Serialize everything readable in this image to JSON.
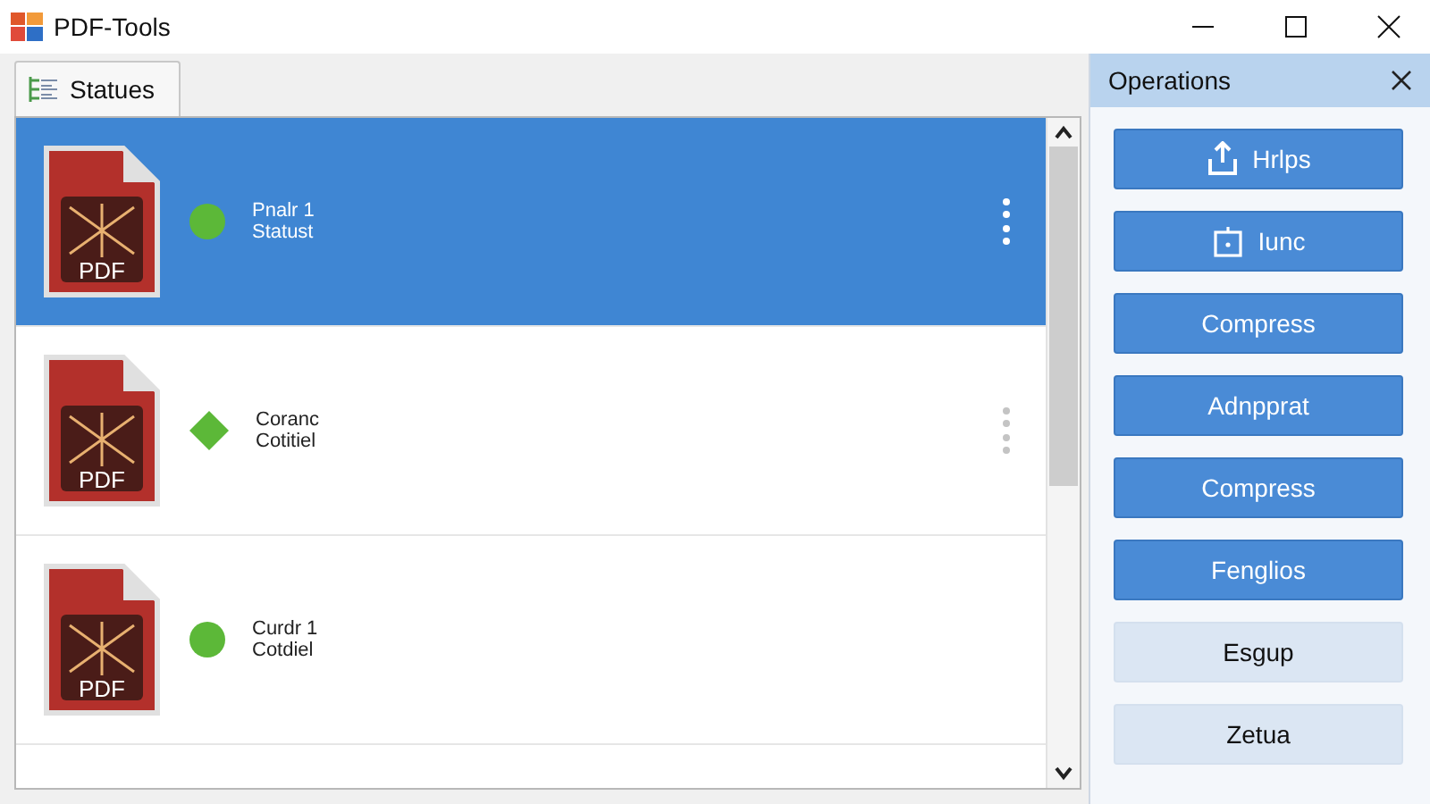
{
  "window": {
    "title": "PDF-Tools"
  },
  "tabs": [
    {
      "label": "Statues",
      "selected": true
    }
  ],
  "files": [
    {
      "type_label": "PDF",
      "line1": "Pnalr 1",
      "line2": "Statust",
      "selected": true,
      "kind": "circle",
      "menu": true
    },
    {
      "type_label": "PDF",
      "line1": "Coranc",
      "line2": "Cotitiel",
      "selected": false,
      "kind": "diamond",
      "menu": true
    },
    {
      "type_label": "PDF",
      "line1": "Curdr 1",
      "line2": "Cotdiel",
      "selected": false,
      "kind": "circle",
      "menu": false
    }
  ],
  "operations": {
    "title": "Operations",
    "buttons": [
      {
        "label": "Hrlps",
        "kind": "upload"
      },
      {
        "label": "Iunc",
        "kind": "frame"
      },
      {
        "label": "Compress",
        "kind": "plain"
      },
      {
        "label": "Adnpprat",
        "kind": "plain"
      },
      {
        "label": "Compress",
        "kind": "plain"
      },
      {
        "label": "Fenglios",
        "kind": "plain"
      },
      {
        "label": "Esgup",
        "kind": "light"
      },
      {
        "label": "Zetua",
        "kind": "light"
      }
    ]
  }
}
